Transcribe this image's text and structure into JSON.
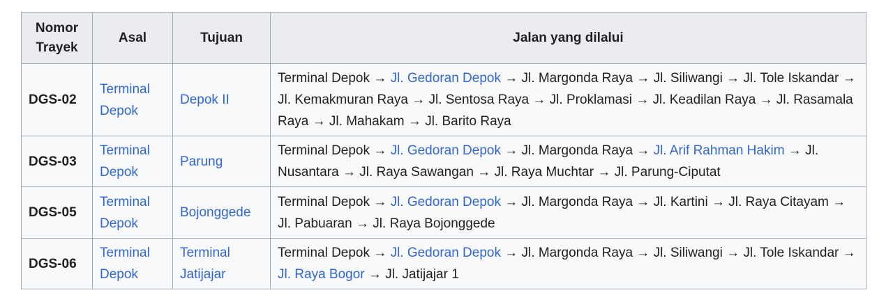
{
  "table": {
    "headers": [
      "Nomor Trayek",
      "Asal",
      "Tujuan",
      "Jalan yang dilalui"
    ],
    "rows": [
      {
        "code": "DGS-02",
        "origin": "Terminal Depok",
        "destination": "Depok II",
        "route": [
          {
            "text": "Terminal Depok",
            "link": false
          },
          {
            "text": "Jl. Gedoran Depok",
            "link": true
          },
          {
            "text": "Jl. Margonda Raya",
            "link": false
          },
          {
            "text": "Jl. Siliwangi",
            "link": false
          },
          {
            "text": "Jl. Tole Iskandar",
            "link": false
          },
          {
            "text": "Jl. Kemakmuran Raya",
            "link": false
          },
          {
            "text": "Jl. Sentosa Raya",
            "link": false
          },
          {
            "text": "Jl. Proklamasi",
            "link": false
          },
          {
            "text": "Jl. Keadilan Raya",
            "link": false
          },
          {
            "text": "Jl. Rasamala Raya",
            "link": false
          },
          {
            "text": "Jl. Mahakam",
            "link": false
          },
          {
            "text": "Jl. Barito Raya",
            "link": false
          }
        ]
      },
      {
        "code": "DGS-03",
        "origin": "Terminal Depok",
        "destination": "Parung",
        "route": [
          {
            "text": "Terminal Depok",
            "link": false
          },
          {
            "text": "Jl. Gedoran Depok",
            "link": true
          },
          {
            "text": "Jl. Margonda Raya",
            "link": false
          },
          {
            "text": "Jl. Arif Rahman Hakim",
            "link": true
          },
          {
            "text": "Jl. Nusantara",
            "link": false
          },
          {
            "text": "Jl. Raya Sawangan",
            "link": false
          },
          {
            "text": "Jl. Raya Muchtar",
            "link": false
          },
          {
            "text": "Jl. Parung-Ciputat",
            "link": false
          }
        ]
      },
      {
        "code": "DGS-05",
        "origin": "Terminal Depok",
        "destination": "Bojonggede",
        "route": [
          {
            "text": "Terminal Depok",
            "link": false
          },
          {
            "text": "Jl. Gedoran Depok",
            "link": true
          },
          {
            "text": "Jl. Margonda Raya",
            "link": false
          },
          {
            "text": "Jl. Kartini",
            "link": false
          },
          {
            "text": "Jl. Raya Citayam",
            "link": false
          },
          {
            "text": "Jl. Pabuaran",
            "link": false
          },
          {
            "text": "Jl. Raya Bojonggede",
            "link": false
          }
        ]
      },
      {
        "code": "DGS-06",
        "origin": "Terminal Depok",
        "destination": "Terminal Jatijajar",
        "route": [
          {
            "text": "Terminal Depok",
            "link": false
          },
          {
            "text": "Jl. Gedoran Depok",
            "link": true
          },
          {
            "text": "Jl. Margonda Raya",
            "link": false
          },
          {
            "text": "Jl. Siliwangi",
            "link": false
          },
          {
            "text": "Jl. Tole Iskandar",
            "link": false
          },
          {
            "text": "Jl. Raya Bogor",
            "link": true
          },
          {
            "text": "Jl. Jatijajar 1",
            "link": false
          }
        ]
      }
    ],
    "arrow": "→"
  }
}
